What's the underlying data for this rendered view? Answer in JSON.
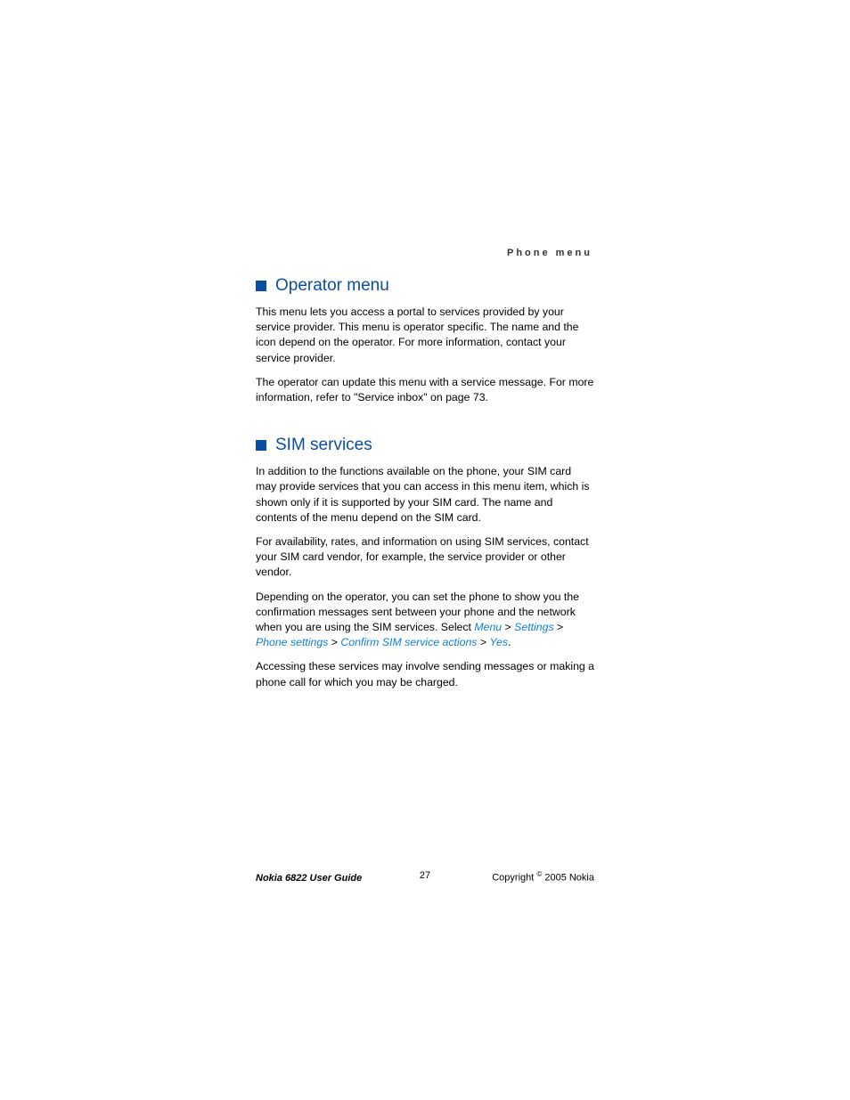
{
  "header": {
    "label": "Phone menu"
  },
  "sections": [
    {
      "heading": "Operator menu",
      "paragraphs": [
        {
          "text": "This menu lets you access a portal to services provided by your service provider. This menu is operator specific. The name and the icon depend on the operator. For more information, contact your service provider."
        },
        {
          "text": "The operator can update this menu with a service message. For more information, refer to \"Service inbox\" on page 73."
        }
      ]
    },
    {
      "heading": "SIM services",
      "paragraphs": [
        {
          "text": "In addition to the functions available on the phone, your SIM card may provide services that you can access in this menu item, which is shown only if it is supported by your SIM card. The name and contents of the menu depend on the SIM card."
        },
        {
          "text": "For availability, rates, and information on using SIM services, contact your SIM card vendor, for example, the service provider or other vendor."
        },
        {
          "prefix": "Depending on the operator, you can set the phone to show you the confirmation messages sent between your phone and the network when you are using the SIM services. Select ",
          "links": {
            "menu": "Menu",
            "settings": "Settings",
            "phone_settings": "Phone settings",
            "confirm": "Confirm SIM service actions",
            "yes": "Yes"
          },
          "gt": " > ",
          "suffix": "."
        },
        {
          "text": "Accessing these services may involve sending messages or making a phone call for which you may be charged."
        }
      ]
    }
  ],
  "footer": {
    "left": "Nokia 6822 User Guide",
    "center": "27",
    "right_prefix": "Copyright ",
    "right_sup": "©",
    "right_suffix": " 2005 Nokia"
  }
}
